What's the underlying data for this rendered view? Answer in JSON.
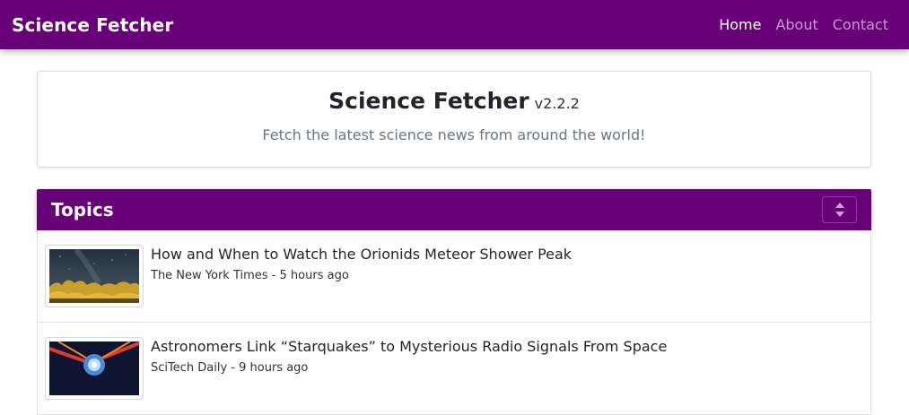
{
  "navbar": {
    "brand": "Science Fetcher",
    "links": [
      {
        "label": "Home",
        "active": true
      },
      {
        "label": "About",
        "active": false
      },
      {
        "label": "Contact",
        "active": false
      }
    ],
    "color": "#680077"
  },
  "header": {
    "title": "Science Fetcher",
    "version": "v2.2.2",
    "subtitle": "Fetch the latest science news from around the world!"
  },
  "topics": {
    "title": "Topics",
    "sort_icon": "sort-icon",
    "items": [
      {
        "title": "How and When to Watch the Orionids Meteor Shower Peak",
        "meta": "The New York Times - 5 hours ago",
        "thumbnail": "night-sky-forest-image"
      },
      {
        "title": "Astronomers Link “Starquakes” to Mysterious Radio Signals From Space",
        "meta": "SciTech Daily - 9 hours ago",
        "thumbnail": "neutron-star-burst-image"
      }
    ]
  }
}
